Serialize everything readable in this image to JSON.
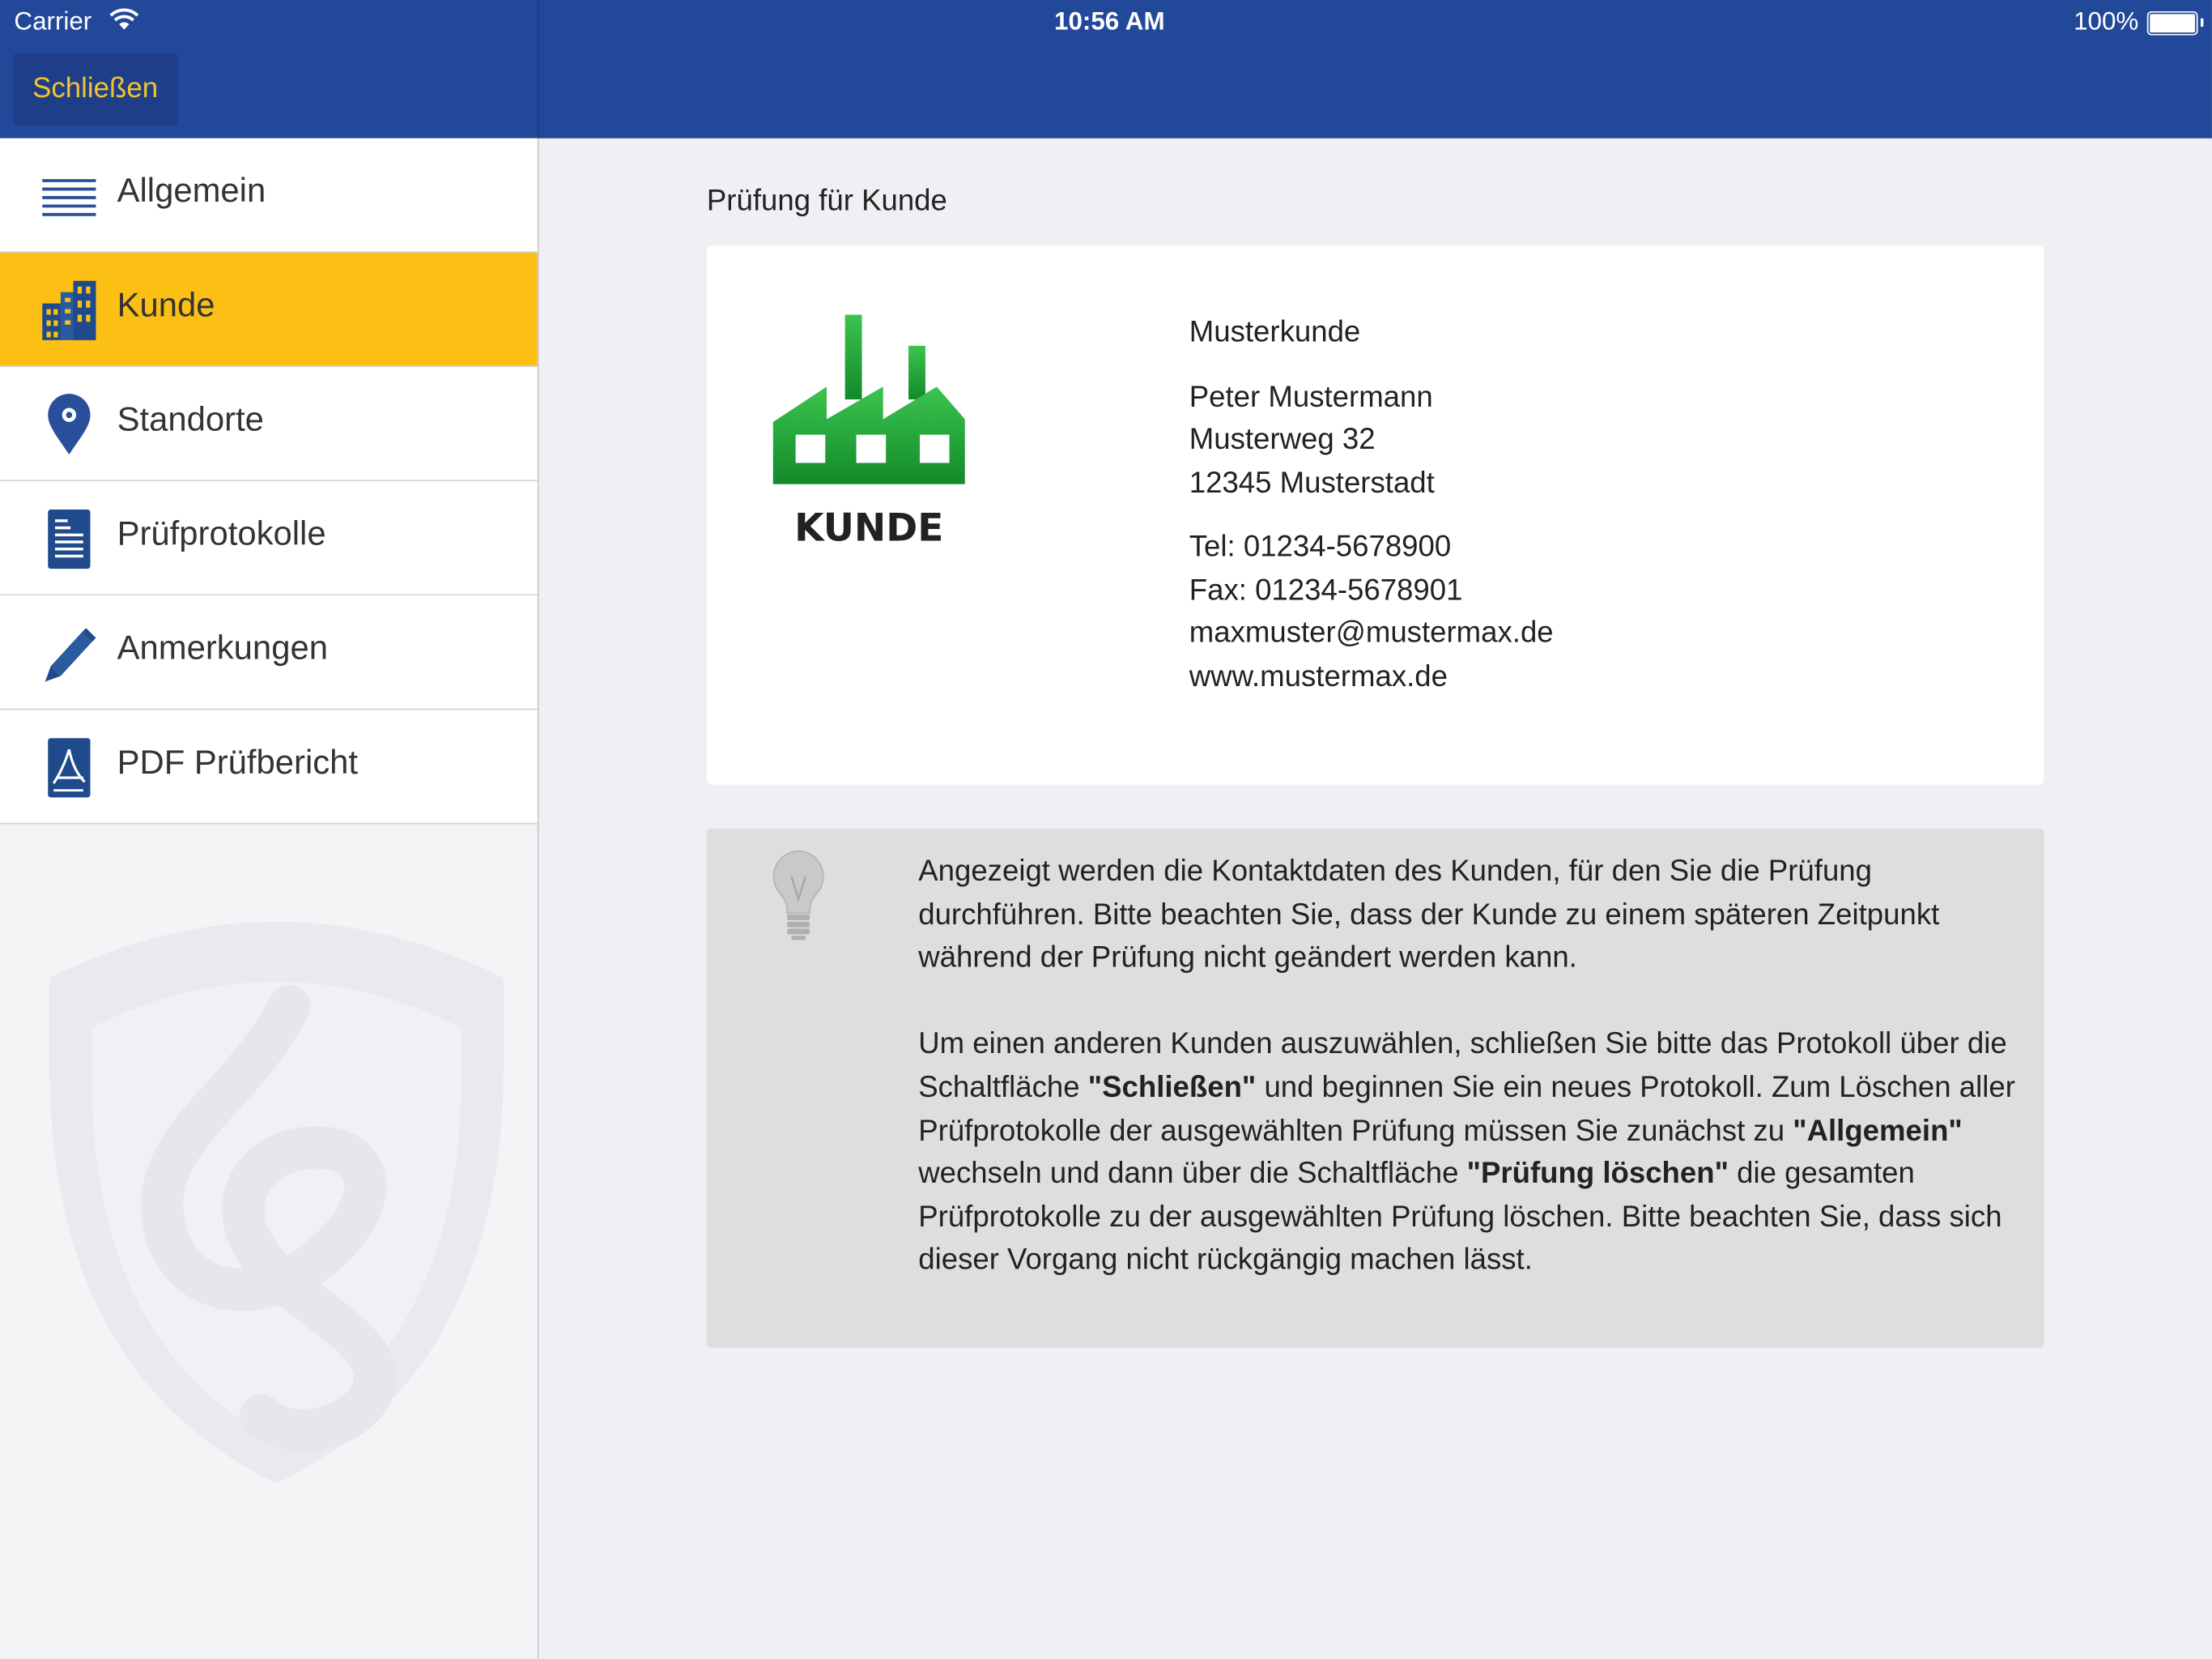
{
  "status_bar": {
    "carrier": "Carrier",
    "time": "10:56 AM",
    "battery": "100%"
  },
  "navbar": {
    "close_label": "Schließen"
  },
  "sidebar": {
    "items": [
      {
        "label": "Allgemein",
        "icon": "list-icon"
      },
      {
        "label": "Kunde",
        "icon": "buildings-icon",
        "active": true
      },
      {
        "label": "Standorte",
        "icon": "map-pin-icon"
      },
      {
        "label": "Prüfprotokolle",
        "icon": "document-icon"
      },
      {
        "label": "Anmerkungen",
        "icon": "pencil-icon"
      },
      {
        "label": "PDF Prüfbericht",
        "icon": "pdf-icon"
      }
    ]
  },
  "main": {
    "section_title": "Prüfung für Kunde",
    "logo_text": "KUNDE",
    "customer": {
      "company": "Musterkunde",
      "name": "Peter Mustermann",
      "street": "Musterweg 32",
      "city": "12345 Musterstadt",
      "tel": "Tel: 01234-5678900",
      "fax": "Fax: 01234-5678901",
      "email": "maxmuster@mustermax.de",
      "web": "www.mustermax.de"
    },
    "info": {
      "p1": "Angezeigt werden die Kontaktdaten des Kunden, für den Sie die Prüfung durchführen. Bitte beachten Sie, dass der Kunde zu einem späteren Zeitpunkt während der Prüfung nicht geändert werden kann.",
      "p2_a": "Um einen anderen Kunden auszuwählen, schließen Sie bitte das Protokoll über die Schaltfläche ",
      "p2_b": "\"Schließen\"",
      "p2_c": " und beginnen Sie ein neues Protokoll. Zum Löschen aller Prüfprotokolle der ausgewählten Prüfung müssen Sie zunächst zu ",
      "p2_d": "\"Allgemein\"",
      "p2_e": " wechseln und dann über die Schaltfläche ",
      "p2_f": "\"Prüfung löschen\"",
      "p2_g": " die gesamten Prüfprotokolle zu der ausgewählten Prüfung löschen. Bitte beachten Sie, dass sich dieser Vorgang nicht rückgängig machen lässt."
    }
  },
  "colors": {
    "navbar": "#224899",
    "accent": "#fcbf13",
    "close_text": "#f1c32e",
    "icon_blue": "#2a4f9a",
    "logo_green": "#1e9a3a"
  }
}
